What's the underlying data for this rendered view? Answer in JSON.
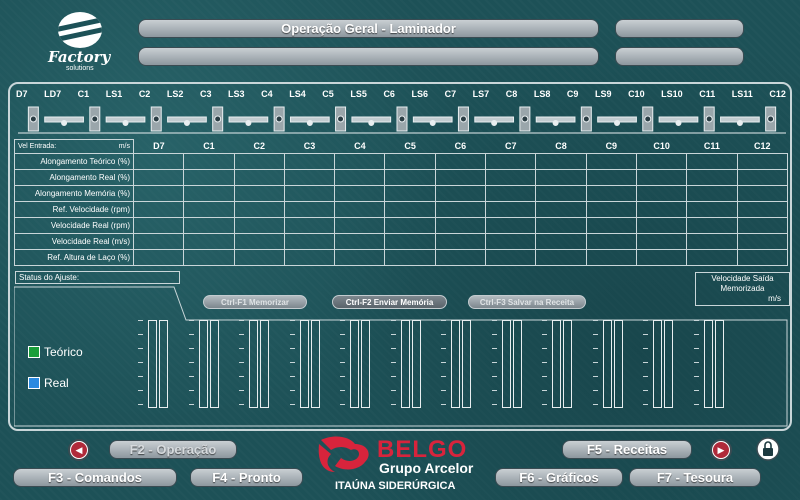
{
  "header": {
    "title": "Operação Geral - Laminador",
    "logo_name": "Factory",
    "logo_sub": "solutions"
  },
  "stands": [
    "D7",
    "LD7",
    "C1",
    "LS1",
    "C2",
    "LS2",
    "C3",
    "LS3",
    "C4",
    "LS4",
    "C5",
    "LS5",
    "C6",
    "LS6",
    "C7",
    "LS7",
    "C8",
    "LS8",
    "C9",
    "LS9",
    "C10",
    "LS10",
    "C11",
    "LS11",
    "C12"
  ],
  "table": {
    "columns": [
      "D7",
      "C1",
      "C2",
      "C3",
      "C4",
      "C5",
      "C6",
      "C7",
      "C8",
      "C9",
      "C10",
      "C11",
      "C12"
    ],
    "vel_entrada_label": "Vel Entrada:",
    "vel_entrada_unit": "m/s",
    "rows": [
      "Alongamento Teórico (%)",
      "Alongamento Real (%)",
      "Alongamento Memória (%)",
      "Ref. Velocidade (rpm)",
      "Velocidade Real (rpm)",
      "Velocidade Real (m/s)",
      "Ref. Altura de Laço (%)"
    ]
  },
  "status_label": "Status do Ajuste:",
  "vel_saida": {
    "l1": "Velocidade Saída",
    "l2": "Memorizada",
    "unit": "m/s"
  },
  "buttons": {
    "memorizar": "Ctrl-F1 Memorizar",
    "enviar": "Ctrl-F2 Enviar Memória",
    "salvar": "Ctrl-F3 Salvar na Receita"
  },
  "legend": {
    "teorico": "Teórico",
    "real": "Real"
  },
  "colors": {
    "teorico": "#1a9e3a",
    "real": "#2a8ae0",
    "brand_red": "#d8243c"
  },
  "fkeys": {
    "f2": "F2 - Operação",
    "f3": "F3 - Comandos",
    "f4": "F4 - Pronto",
    "f5": "F5 - Receitas",
    "f6": "F6 - Gráficos",
    "f7": "F7 - Tesoura"
  },
  "brand": {
    "name": "BELGO",
    "group": "Grupo Arcelor",
    "site": "ITAÚNA SIDERÚRGICA"
  },
  "icons": {
    "prev": "arrow-left-icon",
    "next": "arrow-right-icon",
    "lock": "lock-icon"
  }
}
